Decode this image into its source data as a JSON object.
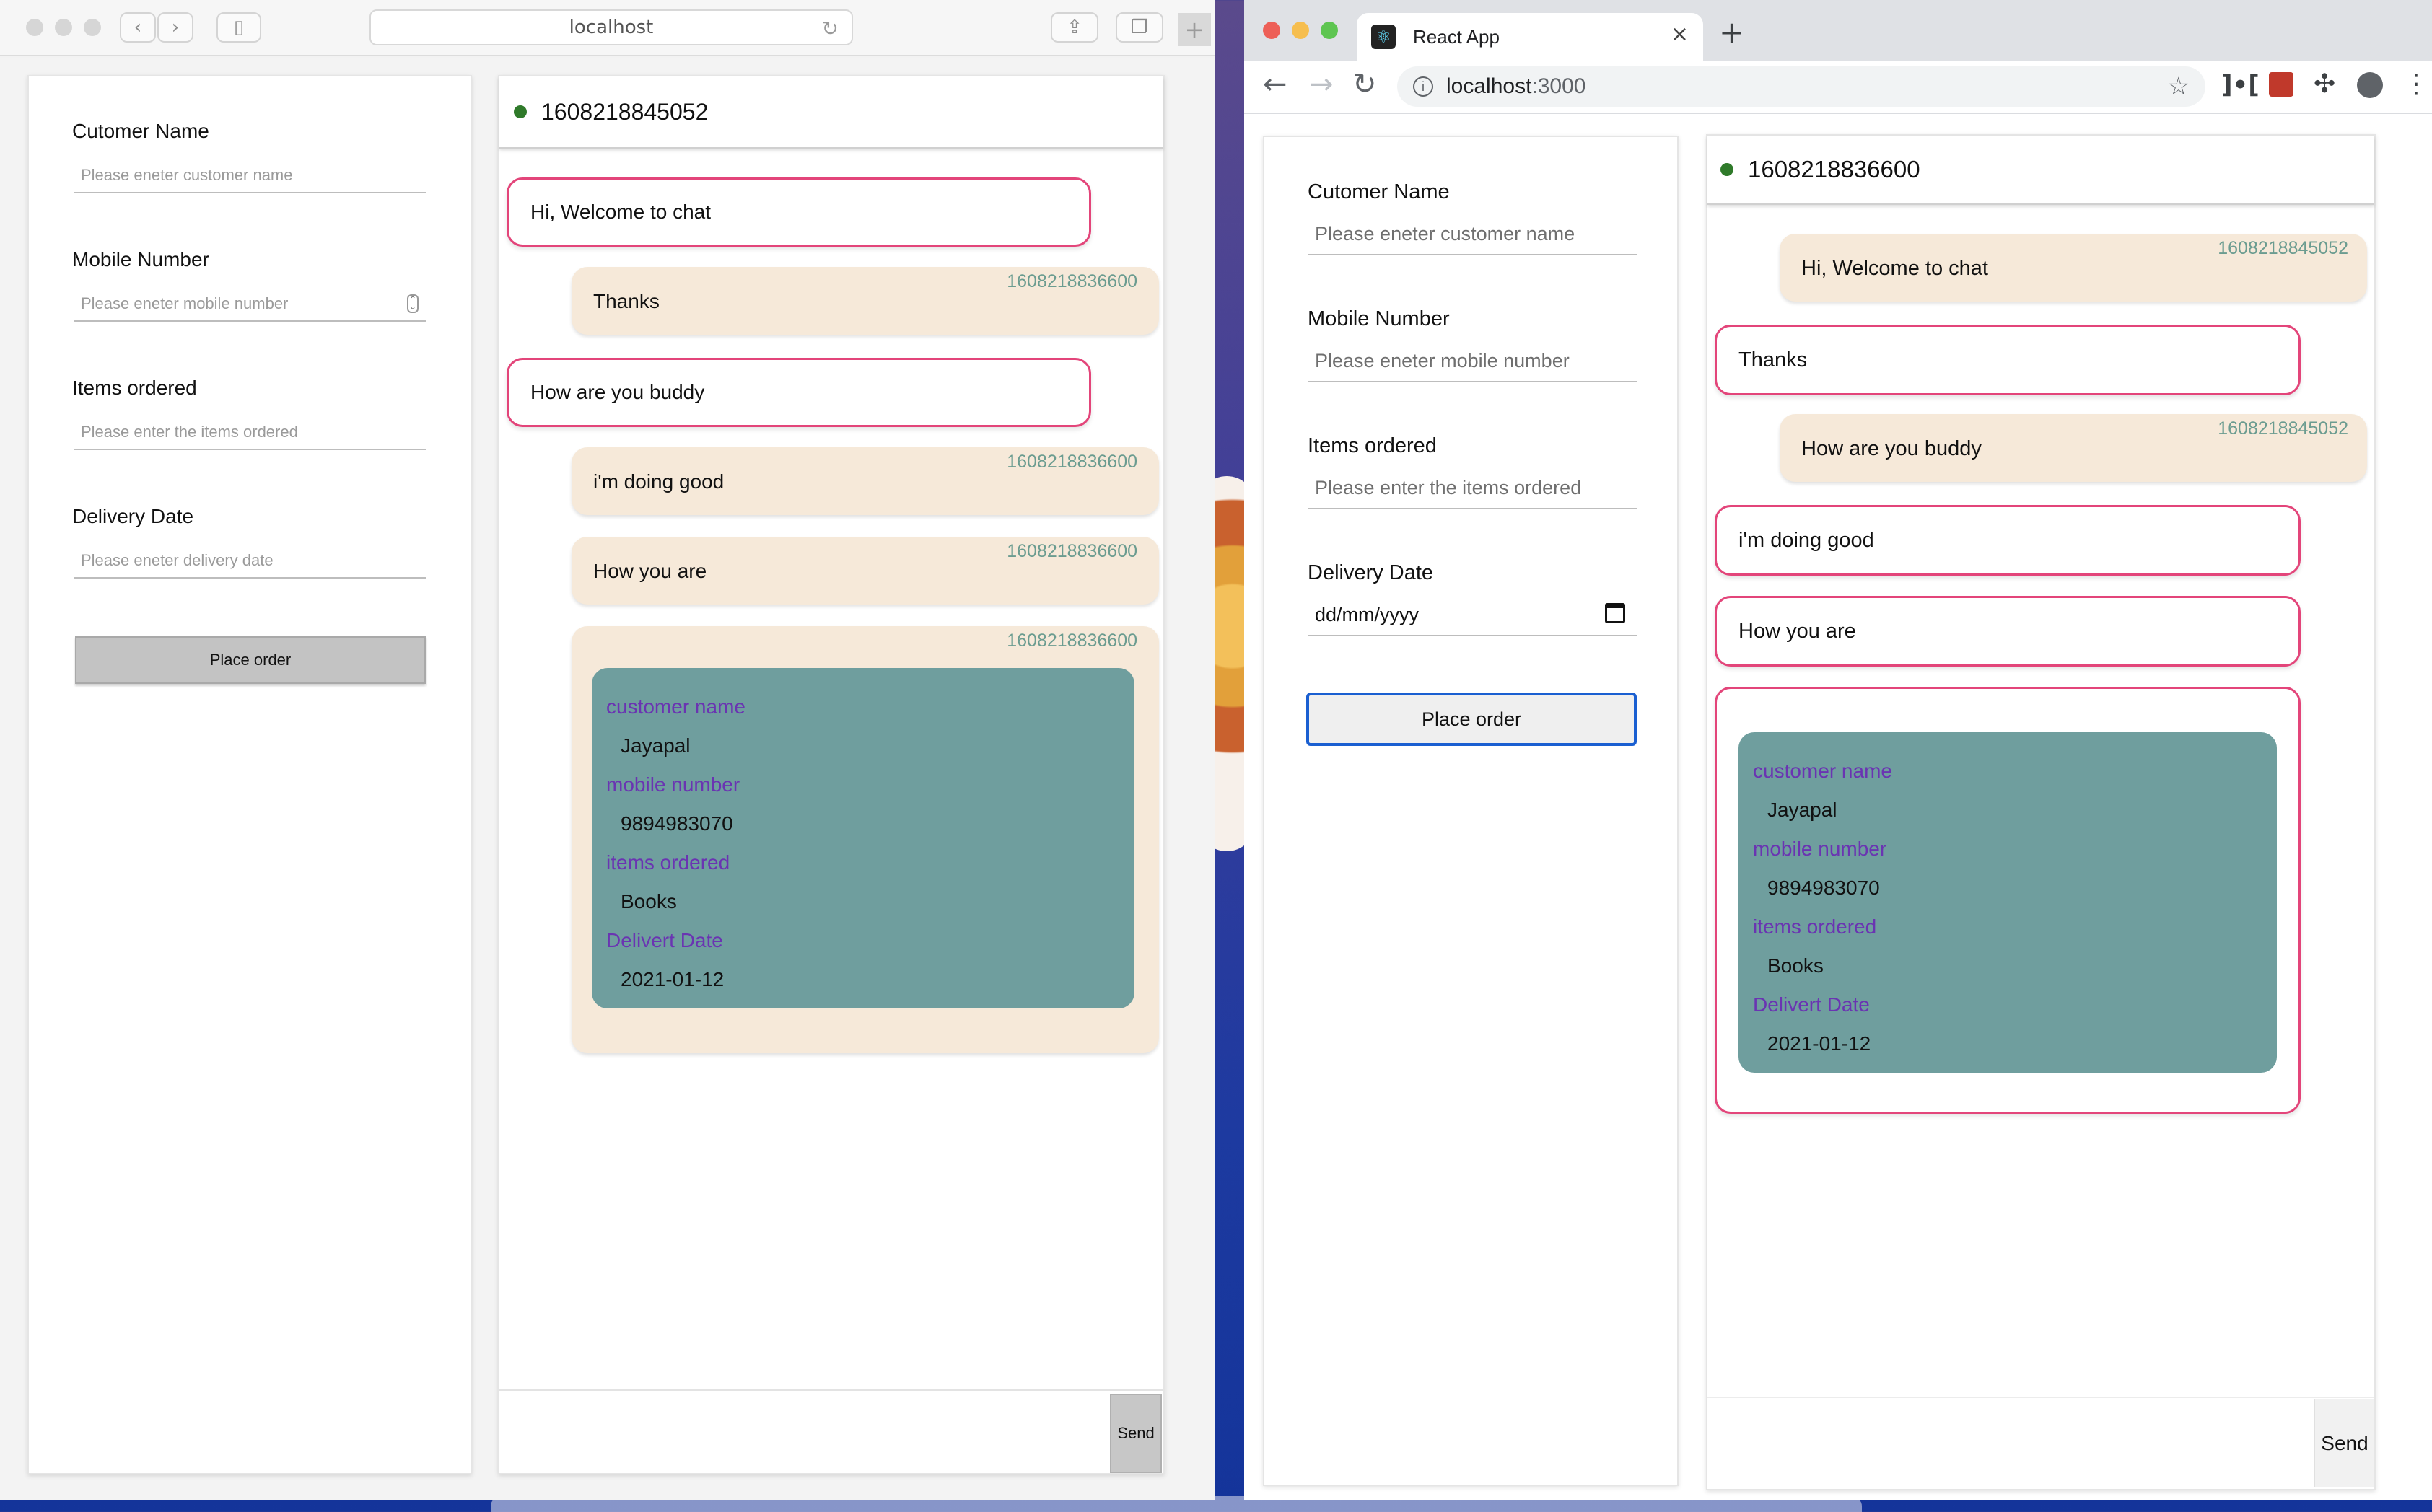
{
  "window1": {
    "url": "localhost",
    "form": {
      "customer_name_label": "Cutomer Name",
      "customer_name_placeholder": "Please eneter customer name",
      "mobile_label": "Mobile Number",
      "mobile_placeholder": "Please eneter mobile number",
      "items_label": "Items ordered",
      "items_placeholder": "Please enter the items ordered",
      "date_label": "Delivery Date",
      "date_placeholder": "Please eneter delivery date",
      "place_order": "Place order"
    },
    "chat": {
      "header_id": "1608218845052",
      "messages": [
        {
          "text": "Hi, Welcome to chat"
        },
        {
          "text": "Thanks",
          "timestamp": "1608218836600"
        },
        {
          "text": "How are you buddy"
        },
        {
          "text": "i'm doing good",
          "timestamp": "1608218836600"
        },
        {
          "text": "How you are",
          "timestamp": "1608218836600"
        }
      ],
      "order_timestamp": "1608218836600",
      "send": "Send"
    }
  },
  "window2": {
    "tab_title": "React App",
    "url_host": "localhost",
    "url_port": ":3000",
    "form": {
      "customer_name_label": "Cutomer Name",
      "customer_name_placeholder": "Please eneter customer name",
      "mobile_label": "Mobile Number",
      "mobile_placeholder": "Please eneter mobile number",
      "items_label": "Items ordered",
      "items_placeholder": "Please enter the items ordered",
      "date_label": "Delivery Date",
      "date_value": "dd/mm/yyyy",
      "place_order": "Place order"
    },
    "chat": {
      "header_id": "1608218836600",
      "messages": [
        {
          "text": "Hi, Welcome to chat",
          "timestamp": "1608218845052"
        },
        {
          "text": "Thanks"
        },
        {
          "text": "How are you buddy",
          "timestamp": "1608218845052"
        },
        {
          "text": "i'm doing good"
        },
        {
          "text": "How you are"
        }
      ],
      "send": "Send"
    }
  },
  "order": {
    "customer_name_key": "customer name",
    "customer_name": "Jayapal",
    "mobile_key": "mobile number",
    "mobile": "9894983070",
    "items_key": "items ordered",
    "items": "Books",
    "date_key": "Delivert Date",
    "date": "2021-01-12"
  },
  "icons": [
    "back-icon",
    "forward-icon",
    "sidebar-icon",
    "reload-icon",
    "share-icon",
    "tabs-icon",
    "new-tab-icon",
    "close-icon",
    "info-icon",
    "star-icon",
    "extension-icon",
    "profile-icon",
    "menu-icon",
    "calendar-icon",
    "stepper-icon",
    "react-icon"
  ],
  "colors": {
    "accent_pink": "#e3457a",
    "bubble_in": "#f6e9d9",
    "order_card": "#6f9e9e",
    "key_purple": "#6a34b2",
    "timestamp": "#6b9c90",
    "online_dot": "#2f7a2a"
  }
}
